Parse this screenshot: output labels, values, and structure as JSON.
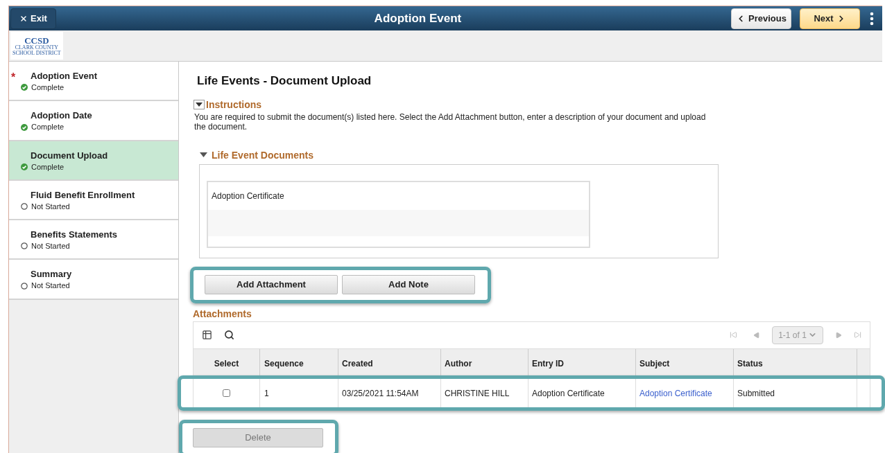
{
  "header": {
    "exit": "Exit",
    "title": "Adoption Event",
    "previous": "Previous",
    "next": "Next"
  },
  "logo": {
    "mark": "CCSD",
    "line_1": "CLARK COUNTY",
    "line_2": "SCHOOL DISTRICT"
  },
  "sidebar": {
    "required_symbol": "*",
    "items": [
      {
        "title": "Adoption Event",
        "status": "Complete",
        "kind": "complete",
        "required": true,
        "selected": false
      },
      {
        "title": "Adoption Date",
        "status": "Complete",
        "kind": "complete",
        "required": false,
        "selected": false
      },
      {
        "title": "Document Upload",
        "status": "Complete",
        "kind": "complete",
        "required": false,
        "selected": true
      },
      {
        "title": "Fluid Benefit Enrollment",
        "status": "Not Started",
        "kind": "not_started",
        "required": false,
        "selected": false
      },
      {
        "title": "Benefits Statements",
        "status": "Not Started",
        "kind": "not_started",
        "required": false,
        "selected": false
      },
      {
        "title": "Summary",
        "status": "Not Started",
        "kind": "not_started",
        "required": false,
        "selected": false
      }
    ]
  },
  "main": {
    "title": "Life Events - Document Upload",
    "instructions": {
      "heading": "Instructions",
      "expanded": true,
      "text": "You are required to submit the document(s) listed here. Select the Add Attachment button, enter a description of your document and upload the document."
    },
    "documents": {
      "heading": "Life Event Documents",
      "expanded": true,
      "items": [
        "Adoption Certificate"
      ]
    },
    "buttons": [
      "Add Attachment",
      "Add Note"
    ],
    "attachments": {
      "heading": "Attachments",
      "pager": "1-1 of 1",
      "columns": [
        "Select",
        "Sequence",
        "Created",
        "Author",
        "Entry ID",
        "Subject",
        "Status"
      ],
      "rows": [
        {
          "cells": [
            {
              "kind": "checkbox",
              "checked": false
            },
            {
              "text": "1",
              "kind": "text"
            },
            {
              "text": "03/25/2021 11:54AM",
              "kind": "text"
            },
            {
              "text": "CHRISTINE HILL",
              "kind": "text"
            },
            {
              "text": "Adoption Certificate",
              "kind": "text"
            },
            {
              "text": "Adoption Certificate",
              "kind": "link"
            },
            {
              "text": "Submitted",
              "kind": "text"
            }
          ]
        }
      ]
    },
    "delete": {
      "label": "Delete",
      "disabled": true
    }
  }
}
